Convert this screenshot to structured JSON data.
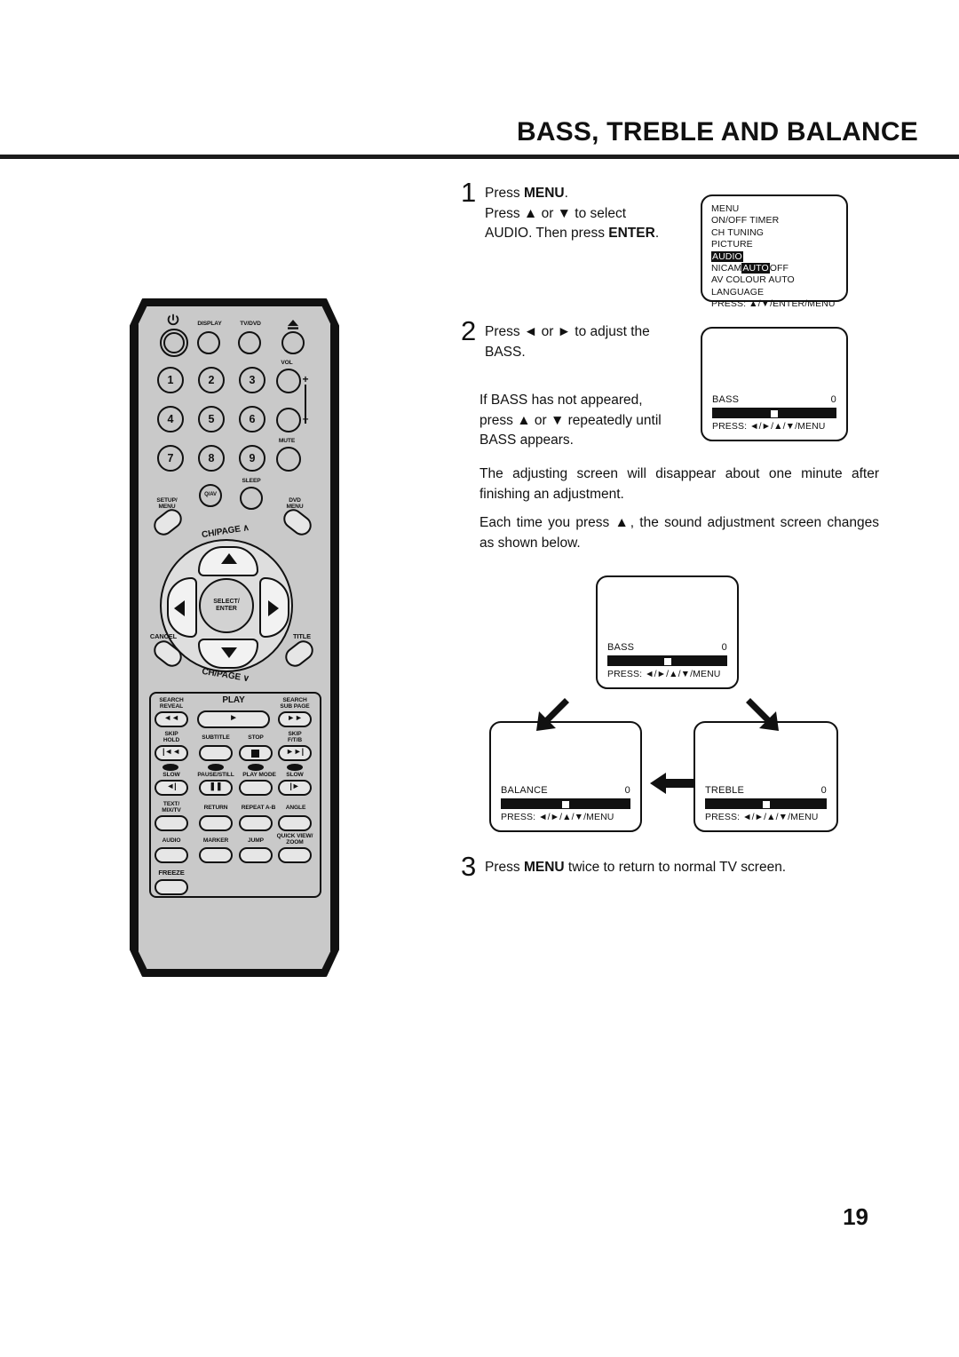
{
  "page": {
    "title": "BASS, TREBLE AND BALANCE",
    "number": "19"
  },
  "steps": {
    "one": {
      "num": "1",
      "line1_pre": "Press ",
      "line1_bold": "MENU",
      "line1_post": ".",
      "line2": "Press ▲ or ▼ to select",
      "line3_pre": "AUDIO. Then press ",
      "line3_bold": "ENTER",
      "line3_post": "."
    },
    "two": {
      "num": "2",
      "line1": "Press ◄ or ► to adjust the",
      "line2": "BASS.",
      "note1": "If BASS has not appeared,",
      "note2": "press ▲ or ▼ repeatedly until",
      "note3": "BASS appears."
    },
    "three": {
      "num": "3",
      "pre": "Press ",
      "bold": "MENU",
      "post": " twice to return to normal  TV screen."
    }
  },
  "paragraphs": {
    "timeout": "The adjusting screen will disappear about one minute after finishing an adjustment.",
    "cycle_intro": "Each time you press ▲, the sound adjustment screen changes as shown below."
  },
  "osd_menu": {
    "items": [
      "MENU",
      "ON/OFF TIMER",
      "CH TUNING",
      "PICTURE"
    ],
    "selected": "AUDIO",
    "nicam_label": "NICAM",
    "nicam_auto": "AUTO",
    "nicam_off": "OFF",
    "av_colour": "AV COLOUR AUTO",
    "language": "LANGUAGE",
    "press": "PRESS: ▲/▼/ENTER/MENU"
  },
  "osd_adjust": {
    "press": "PRESS: ◄/►/▲/▼/MENU",
    "bass": {
      "label": "BASS",
      "value": "0",
      "knob_percent": 50
    },
    "treble": {
      "label": "TREBLE",
      "value": "0",
      "knob_percent": 50
    },
    "balance": {
      "label": "BALANCE",
      "value": "0",
      "knob_percent": 50
    }
  },
  "remote": {
    "power": "power-icon",
    "display": "DISPLAY",
    "tvdvd": "TV/DVD",
    "eject": "▲",
    "vol": "VOL",
    "vol_plus": "+",
    "vol_minus": "–",
    "mute": "MUTE",
    "digits": [
      "1",
      "2",
      "3",
      "4",
      "5",
      "6",
      "7",
      "8",
      "9"
    ],
    "qav": "Q/AV",
    "sleep": "SLEEP",
    "setup_menu_l1": "SETUP/",
    "setup_menu_l2": "MENU",
    "dvd_menu_l1": "DVD",
    "dvd_menu_l2": "MENU",
    "ch_page_up": "CH/PAGE",
    "ch_page_up_caret": "∧",
    "ch_page_down": "CH/PAGE",
    "ch_page_down_caret": "∨",
    "select_enter_l1": "SELECT/",
    "select_enter_l2": "ENTER",
    "cancel": "CANCEL",
    "title": "TITLE",
    "search_reveal_l1": "SEARCH",
    "search_reveal_l2": "REVEAL",
    "play": "PLAY",
    "search_sub_l1": "SEARCH",
    "search_sub_l2": "SUB PAGE",
    "skip_hold_l1": "SKIP",
    "skip_hold_l2": "HOLD",
    "subtitle": "SUBTITLE",
    "stop": "STOP",
    "skip_ftb_l1": "SKIP",
    "skip_ftb_l2": "F/T/B",
    "slow_left": "SLOW",
    "pause_still": "PAUSE/STILL",
    "play_mode": "PLAY MODE",
    "slow_right": "SLOW",
    "text_mix_l1": "TEXT/",
    "text_mix_l2": "MIX/TV",
    "return": "RETURN",
    "repeat_ab": "REPEAT A-B",
    "angle": "ANGLE",
    "audio": "AUDIO",
    "marker": "MARKER",
    "jump": "JUMP",
    "quick_view_l1": "QUICK VIEW/",
    "quick_view_l2": "ZOOM",
    "freeze": "FREEZE"
  }
}
